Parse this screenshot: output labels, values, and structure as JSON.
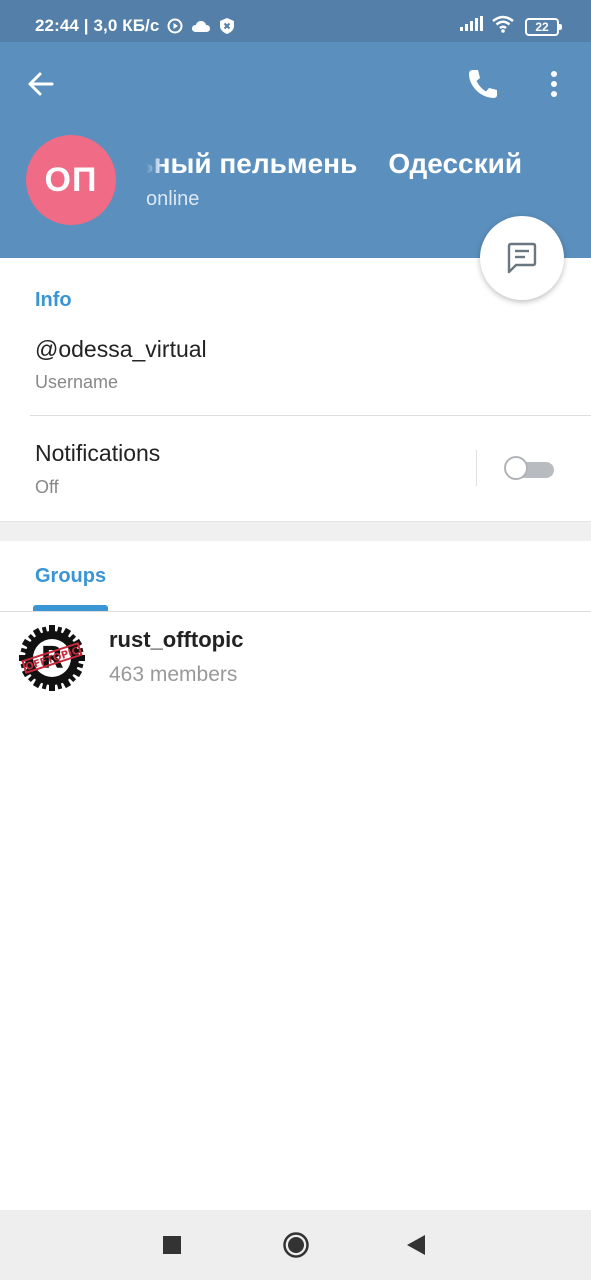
{
  "status_bar": {
    "time_speed": "22:44 | 3,0 КБ/с",
    "battery": "22",
    "icons": [
      "play-circle-icon",
      "cloud-icon",
      "shield-icon",
      "signal-icon",
      "wifi-icon",
      "battery-icon"
    ]
  },
  "header": {
    "avatar_initials": "ОП",
    "avatar_color": "#ef6b86",
    "title": "Одесский Виртуальный пельмень",
    "title_visible": "альный пельмень    Одесский",
    "status": "online",
    "header_color": "#5b8fbd"
  },
  "info": {
    "section_title": "Info",
    "username": "@odessa_virtual",
    "username_label": "Username",
    "notifications_title": "Notifications",
    "notifications_value": "Off"
  },
  "groups": {
    "tab_label": "Groups",
    "items": [
      {
        "name": "rust_offtopic",
        "members": "463 members",
        "avatar_stamp": "OFFTOPIC"
      }
    ]
  },
  "accent_color": "#3a95d5"
}
